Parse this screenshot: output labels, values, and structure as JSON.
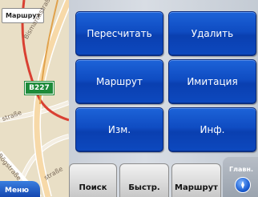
{
  "map": {
    "title": "Маршрут",
    "road_badge": "B227",
    "street_labels": [
      "Bismarckstraße",
      "straße",
      "Bögstraße",
      "straße"
    ]
  },
  "menu_button": {
    "label": "Меню"
  },
  "buttons": [
    {
      "label": "Пересчитать"
    },
    {
      "label": "Удалить"
    },
    {
      "label": "Маршрут"
    },
    {
      "label": "Имитация"
    },
    {
      "label": "Изм."
    },
    {
      "label": "Инф."
    }
  ],
  "tabs": [
    {
      "label": "Поиск"
    },
    {
      "label": "Быстр."
    },
    {
      "label": "Маршрут"
    }
  ],
  "main_corner": {
    "label": "Главн.",
    "icon": "compass-icon"
  },
  "colors": {
    "button_blue": "#0f4cc2",
    "road_badge_green": "#1e8b3a",
    "route_red": "#d94032",
    "map_background": "#e9dfc6"
  }
}
